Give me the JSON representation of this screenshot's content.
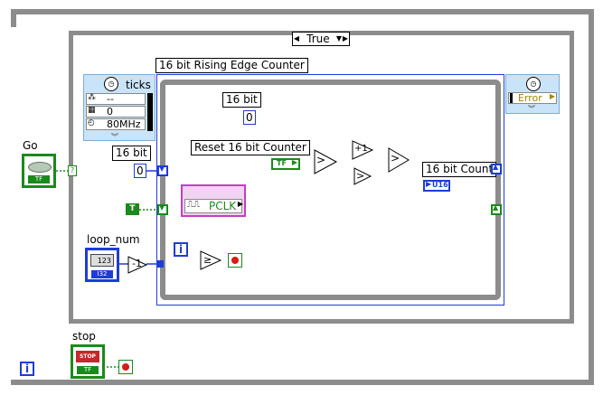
{
  "case_structure": {
    "selector_value": "True"
  },
  "timed_loop": {
    "title": "16 bit Rising Edge Counter",
    "left_node": {
      "title": "ticks",
      "rows": [
        "--",
        "0",
        "80MHz"
      ]
    },
    "right_node": {
      "title": "Error"
    }
  },
  "controls": {
    "go": {
      "label": "Go",
      "type_text": "TF"
    },
    "loop_num": {
      "label": "loop_num",
      "type_text": "I32",
      "icon_text": "123"
    },
    "stop": {
      "label": "stop",
      "type_text": "TF",
      "icon_text": "STOP"
    }
  },
  "inner": {
    "label_16bit_top": "16 bit",
    "const_top": "0",
    "label_16bit_left": "16 bit",
    "const_left": "0",
    "reset_label": "Reset 16 bit Counter",
    "reset_type": "TF",
    "increment_glyph": "+1",
    "io_node": "PCLK",
    "count_label": "16 bit Count",
    "count_type": "U16",
    "true_const": "T",
    "i_terminal": "i",
    "loop_i_terminal": "i"
  },
  "colors": {
    "structure_gray": "#8c8c8c",
    "wire_blue": "#1d3cd8",
    "wire_green": "#1a8a1a",
    "io_magenta": "#c23fc2"
  }
}
